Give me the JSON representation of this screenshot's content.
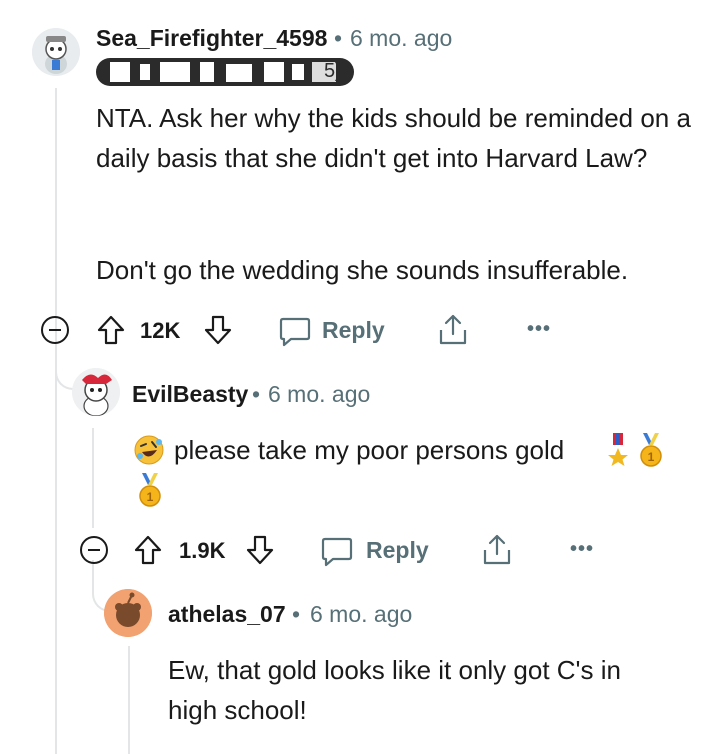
{
  "comments": [
    {
      "username": "Sea_Firefighter_4598",
      "separator": "•",
      "time": "6 mo. ago",
      "flair": "5]",
      "body": [
        "NTA. Ask her why the kids should be reminded on a daily basis that she didn't get into Harvard Law?",
        "Don't go the wedding she sounds insufferable."
      ],
      "score": "12K",
      "reply_label": "Reply"
    },
    {
      "username": "EvilBeasty",
      "separator": "•",
      "time": "6 mo. ago",
      "body": "please take my poor persons gold",
      "emojis": [
        "rofl-emoji",
        "medal-emoji",
        "gold-medal-emoji",
        "gold-medal-emoji"
      ],
      "score": "1.9K",
      "reply_label": "Reply"
    },
    {
      "username": "athelas_07",
      "separator": "•",
      "time": "6 mo. ago",
      "body": "Ew, that gold looks like it only got C's in high school!"
    }
  ],
  "more_label": "•••",
  "colors": {
    "text": "#1a1a1b",
    "meta": "#576f76",
    "thread": "#e3e5e7",
    "avatar_orange": "#f2a271"
  }
}
